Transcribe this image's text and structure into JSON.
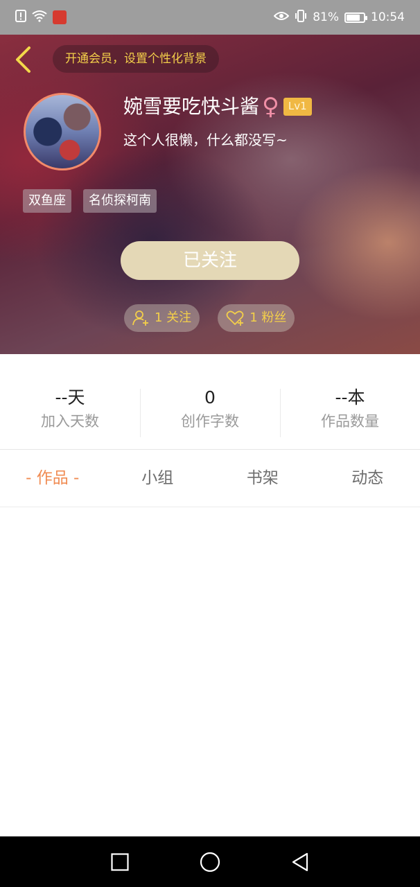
{
  "status_bar": {
    "battery": "81%",
    "battery_level": 0.81,
    "time": "10:54",
    "icons": [
      "alert-icon",
      "wifi-icon",
      "app-notification-icon",
      "eye-icon",
      "vibrate-icon",
      "battery-icon"
    ]
  },
  "header": {
    "back_icon": "chevron-left-icon",
    "vip_prompt": "开通会员，设置个性化背景",
    "username": "婉雪要吃快斗酱",
    "gender_symbol": "♀",
    "level": "Lv1",
    "bio": "这个人很懒，什么都没写~",
    "tags": [
      "双鱼座",
      "名侦探柯南"
    ],
    "follow_button": "已关注",
    "following_count": "1 关注",
    "fans_count": "1 粉丝"
  },
  "stats": [
    {
      "value": "--天",
      "label": "加入天数"
    },
    {
      "value": "0",
      "label": "创作字数"
    },
    {
      "value": "--本",
      "label": "作品数量"
    }
  ],
  "tabs": [
    {
      "label": "- 作品 -",
      "active": true
    },
    {
      "label": "小组",
      "active": false
    },
    {
      "label": "书架",
      "active": false
    },
    {
      "label": "动态",
      "active": false
    }
  ],
  "colors": {
    "accent": "#f08b52",
    "vip_text": "#f3cf4a",
    "level_badge": "#f0b843",
    "follow_button": "#e4d8b6",
    "gender": "#f08fa6"
  }
}
